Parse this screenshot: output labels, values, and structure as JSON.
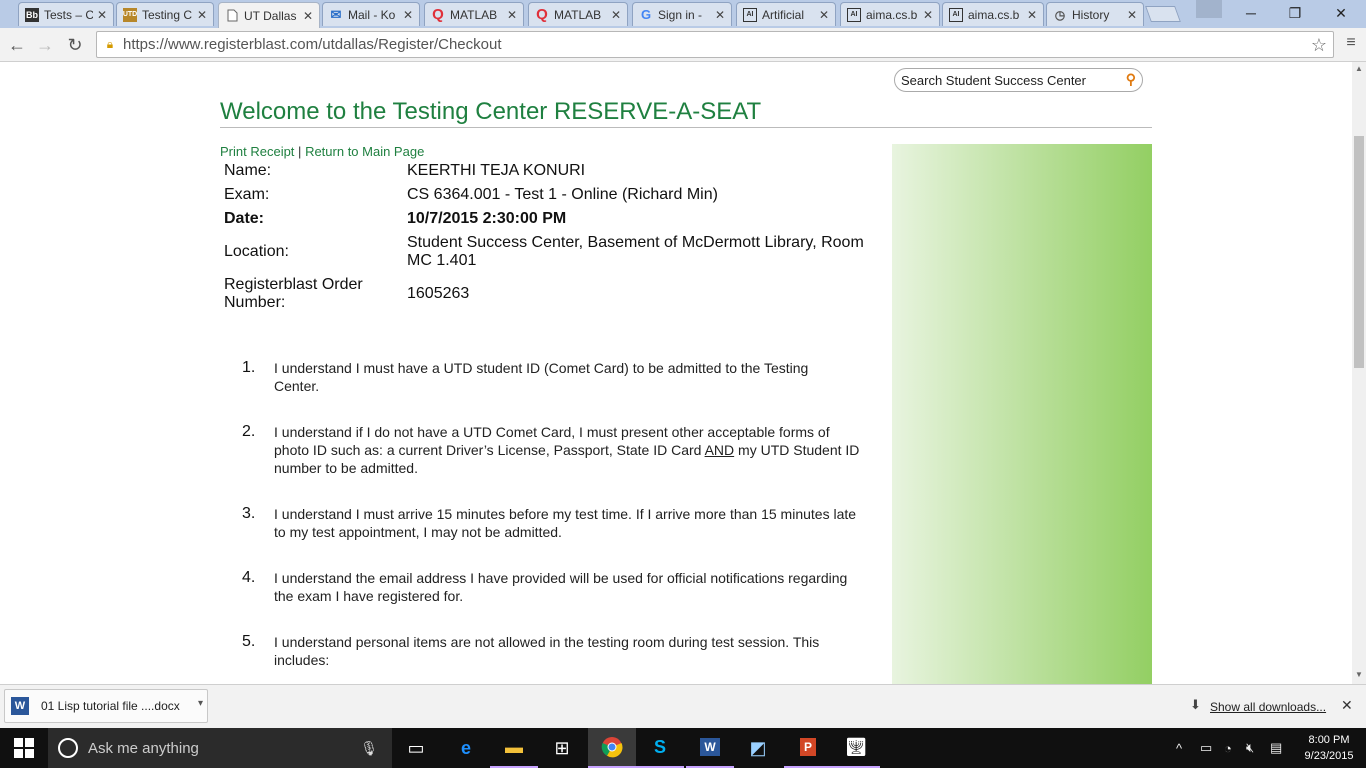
{
  "browser": {
    "tabs": [
      {
        "icon": "Bb",
        "label": "Tests – C",
        "active": false
      },
      {
        "icon": "UTD",
        "label": "Testing C",
        "active": false
      },
      {
        "icon": "doc",
        "label": "UT Dallas",
        "active": true
      },
      {
        "icon": "mail",
        "label": "Mail - Ko",
        "active": false
      },
      {
        "icon": "Q",
        "label": "MATLAB",
        "active": false
      },
      {
        "icon": "Q",
        "label": "MATLAB",
        "active": false
      },
      {
        "icon": "G",
        "label": "Sign in -",
        "active": false
      },
      {
        "icon": "AI",
        "label": "Artificial",
        "active": false
      },
      {
        "icon": "AI",
        "label": "aima.cs.b",
        "active": false
      },
      {
        "icon": "AI",
        "label": "aima.cs.b",
        "active": false
      },
      {
        "icon": "clock",
        "label": "History",
        "active": false
      }
    ],
    "url": "https://www.registerblast.com/utdallas/Register/Checkout"
  },
  "page": {
    "search_placeholder": "Search Student Success Center",
    "heading": "Welcome to the Testing Center RESERVE-A-SEAT",
    "links": {
      "print_receipt": "Print Receipt",
      "separator": "|",
      "return_main": "Return to Main Page"
    },
    "info": {
      "name_label": "Name:",
      "name_value": "KEERTHI TEJA KONURI",
      "exam_label": "Exam:",
      "exam_value": "CS 6364.001 - Test 1 - Online (Richard Min)",
      "date_label": "Date:",
      "date_value": "10/7/2015 2:30:00 PM",
      "location_label": "Location:",
      "location_line1": "Student Success Center, Basement of McDermott Library, Room",
      "location_line2": "MC 1.401",
      "order_label_line1": "Registerblast Order",
      "order_label_line2": "Number:",
      "order_value": "1605263"
    },
    "terms": [
      {
        "num": "1.",
        "line1": "I understand I must have a UTD student ID (Comet Card) to be admitted to the Testing",
        "line2": "Center."
      },
      {
        "num": "2.",
        "line1": "I understand if I do not have a UTD Comet Card, I must present other acceptable forms of",
        "line2a": "photo ID such as: a current Driver’s License, Passport, State ID Card ",
        "line2_und": "AND",
        "line2b": " my UTD Student ID",
        "line3": "number to be admitted."
      },
      {
        "num": "3.",
        "line1": "I understand I must arrive 15 minutes before my test time. If I arrive more than 15 minutes late",
        "line2": "to my test appointment, I may not be admitted."
      },
      {
        "num": "4.",
        "line1": "I understand the email address I have provided will be used for official notifications regarding",
        "line2": "the exam I have registered for."
      },
      {
        "num": "5.",
        "line1": "I understand personal items are not allowed in the testing room during test session. This",
        "line2": "includes:"
      }
    ]
  },
  "downloads": {
    "file": "01 Lisp tutorial file ....docx",
    "show_all": "Show all downloads..."
  },
  "taskbar": {
    "search_placeholder": "Ask me anything",
    "time": "8:00 PM",
    "date": "9/23/2015"
  }
}
